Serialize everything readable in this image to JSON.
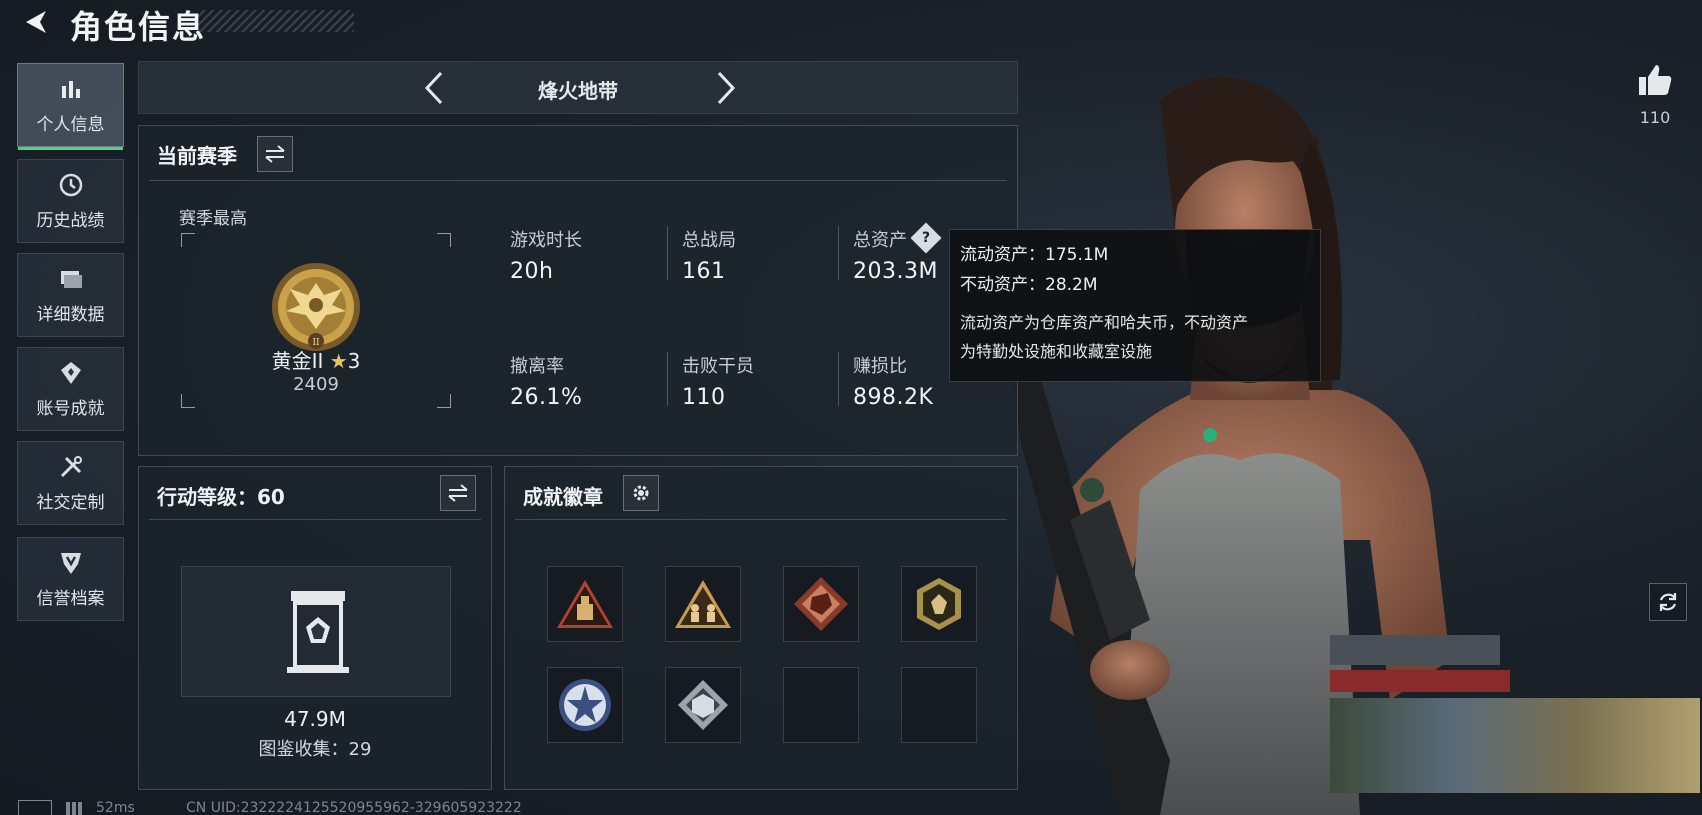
{
  "header": {
    "title": "角色信息"
  },
  "sidebar": {
    "items": [
      {
        "label": "个人信息",
        "icon": "bar-chart-icon",
        "active": true
      },
      {
        "label": "历史战绩",
        "icon": "clock-icon",
        "active": false
      },
      {
        "label": "详细数据",
        "icon": "folder-icon",
        "active": false
      },
      {
        "label": "账号成就",
        "icon": "medal-icon",
        "active": false
      },
      {
        "label": "社交定制",
        "icon": "tools-icon",
        "active": false
      },
      {
        "label": "信誉档案",
        "icon": "shield-icon",
        "active": false
      }
    ]
  },
  "season_selector": {
    "label": "烽火地带"
  },
  "current_season": {
    "title": "当前赛季",
    "highest_label": "赛季最高",
    "rank_name": "黄金II",
    "rank_stars": "3",
    "rank_score": "2409",
    "stats": [
      {
        "label": "游戏时长",
        "value": "20h"
      },
      {
        "label": "总战局",
        "value": "161"
      },
      {
        "label": "总资产",
        "value": "203.3M"
      },
      {
        "label": "撤离率",
        "value": "26.1%"
      },
      {
        "label": "击败干员",
        "value": "110"
      },
      {
        "label": "赚损比",
        "value": "898.2K"
      }
    ]
  },
  "tooltip": {
    "liquid": "流动资产：175.1M",
    "fixed": "不动资产：28.2M",
    "desc_line1": "流动资产为仓库资产和哈夫币，不动资产",
    "desc_line2": "为特勤处设施和收藏室设施"
  },
  "action_level": {
    "title": "行动等级：60",
    "value": "47.9M",
    "collection": "图鉴收集：29"
  },
  "achievements": {
    "title": "成就徽章",
    "badges": [
      "triangle-crate-badge",
      "triangle-soldiers-badge",
      "dragon-badge",
      "hexagon-gem-badge",
      "star-emblem-badge",
      "cube-emblem-badge",
      "empty",
      "empty"
    ]
  },
  "like": {
    "count": "110"
  },
  "footer": {
    "ping": "52ms",
    "uid": "CN UID:2322224125520955962-329605923222"
  },
  "colors": {
    "accent": "#3ddc84",
    "gold": "#c9a24a",
    "background": "#1a2129"
  }
}
